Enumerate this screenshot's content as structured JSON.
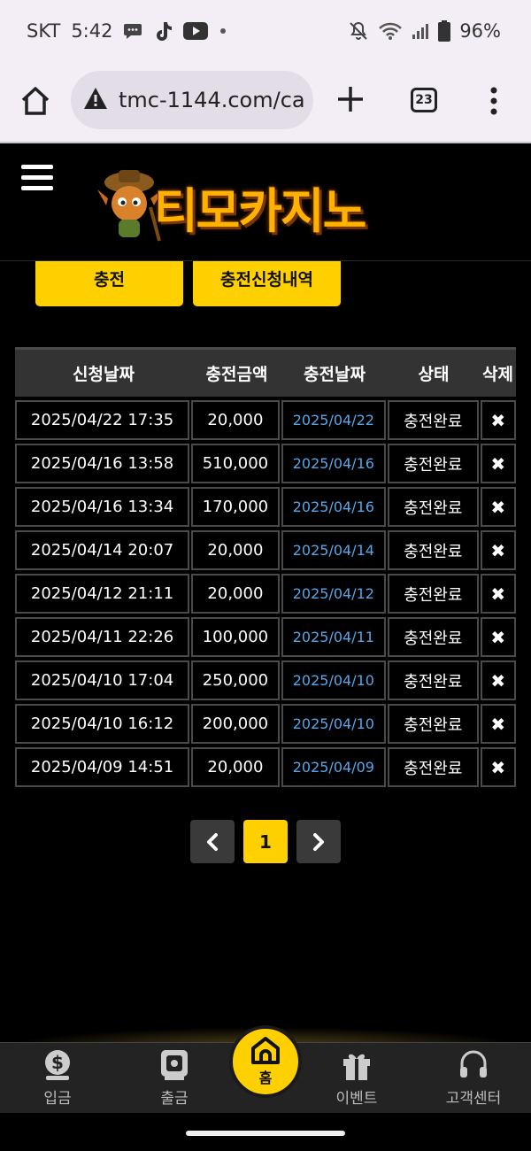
{
  "status_bar": {
    "carrier": "SKT",
    "time": "5:42",
    "battery": "96%",
    "icons": [
      "chat-icon",
      "tiktok-icon",
      "youtube-icon",
      "dot-icon",
      "mute-icon",
      "wifi-icon",
      "signal-icon",
      "battery-icon"
    ]
  },
  "browser": {
    "url": "tmc-1144.com/ca",
    "tab_count": "23",
    "icons": [
      "home-icon",
      "warning-icon",
      "plus-icon",
      "tabs-icon",
      "more-icon"
    ]
  },
  "site": {
    "logo_text": "티모카지노"
  },
  "tabs": {
    "charge": "충전",
    "history": "충전신청내역"
  },
  "table": {
    "headers": {
      "request_date": "신청날짜",
      "amount": "충전금액",
      "charge_date": "충전날짜",
      "status": "상태",
      "delete": "삭제"
    },
    "rows": [
      {
        "request_date": "2025/04/22 17:35",
        "amount": "20,000",
        "charge_date": "2025/04/22",
        "status": "충전완료"
      },
      {
        "request_date": "2025/04/16 13:58",
        "amount": "510,000",
        "charge_date": "2025/04/16",
        "status": "충전완료"
      },
      {
        "request_date": "2025/04/16 13:34",
        "amount": "170,000",
        "charge_date": "2025/04/16",
        "status": "충전완료"
      },
      {
        "request_date": "2025/04/14 20:07",
        "amount": "20,000",
        "charge_date": "2025/04/14",
        "status": "충전완료"
      },
      {
        "request_date": "2025/04/12 21:11",
        "amount": "20,000",
        "charge_date": "2025/04/12",
        "status": "충전완료"
      },
      {
        "request_date": "2025/04/11 22:26",
        "amount": "100,000",
        "charge_date": "2025/04/11",
        "status": "충전완료"
      },
      {
        "request_date": "2025/04/10 17:04",
        "amount": "250,000",
        "charge_date": "2025/04/10",
        "status": "충전완료"
      },
      {
        "request_date": "2025/04/10 16:12",
        "amount": "200,000",
        "charge_date": "2025/04/10",
        "status": "충전완료"
      },
      {
        "request_date": "2025/04/09 14:51",
        "amount": "20,000",
        "charge_date": "2025/04/09",
        "status": "충전완료"
      }
    ],
    "delete_glyph": "✖"
  },
  "pagination": {
    "prev": "‹",
    "current": "1",
    "next": "›"
  },
  "bottom_nav": {
    "deposit": "입금",
    "withdraw": "출금",
    "home": "홈",
    "event": "이벤트",
    "support": "고객센터"
  },
  "colors": {
    "accent": "#ffd000",
    "link_blue": "#58a6e8",
    "background": "#000000",
    "table_header": "#333333"
  }
}
